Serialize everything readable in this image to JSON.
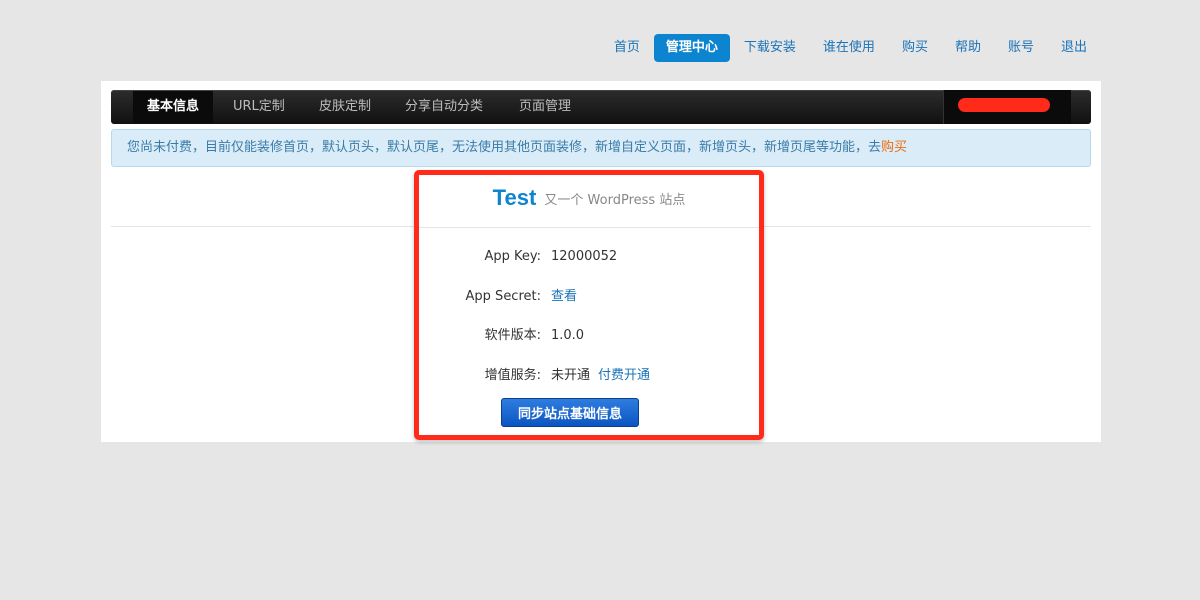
{
  "top_nav": {
    "items": [
      {
        "label": "首页",
        "active": false
      },
      {
        "label": "管理中心",
        "active": true
      },
      {
        "label": "下载安装",
        "active": false
      },
      {
        "label": "谁在使用",
        "active": false
      },
      {
        "label": "购买",
        "active": false
      },
      {
        "label": "帮助",
        "active": false
      },
      {
        "label": "账号",
        "active": false
      },
      {
        "label": "退出",
        "active": false
      }
    ]
  },
  "tabs": {
    "items": [
      {
        "label": "基本信息",
        "active": true
      },
      {
        "label": "URL定制",
        "active": false
      },
      {
        "label": "皮肤定制",
        "active": false
      },
      {
        "label": "分享自动分类",
        "active": false
      },
      {
        "label": "页面管理",
        "active": false
      }
    ]
  },
  "notice": {
    "text": "您尚未付费，目前仅能装修首页，默认页头，默认页尾，无法使用其他页面装修，新增自定义页面，新增页头，新增页尾等功能，去",
    "link": "购买"
  },
  "site": {
    "name": "Test",
    "subtitle": "又一个 WordPress 站点"
  },
  "info": {
    "app_key_label": "App Key:",
    "app_key_value": "12000052",
    "app_secret_label": "App Secret:",
    "app_secret_link": "查看",
    "version_label": "软件版本:",
    "version_value": "1.0.0",
    "service_label": "增值服务:",
    "service_value": "未开通",
    "service_link": "付费开通"
  },
  "sync_button": "同步站点基础信息",
  "colors": {
    "accent": "#0d84cf",
    "highlight_border": "#ff2a1a",
    "buy_link": "#f06a0c"
  }
}
